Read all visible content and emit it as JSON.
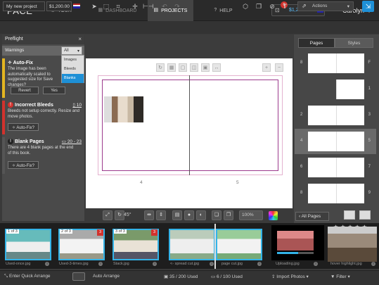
{
  "app": {
    "logo": "PACE"
  },
  "nav": {
    "tour": "TOUR",
    "dashboard": "DASHBOARD",
    "projects": "PROJECTS",
    "help": "HELP"
  },
  "cart": {
    "count": "1",
    "price": "$1,234.56"
  },
  "user": {
    "name": "Carolyn"
  },
  "toolbar": {
    "project_name": "My new project",
    "project_price": "$1,200.00",
    "actions_label": "Actions"
  },
  "preflight": {
    "title": "Preflight",
    "close": "×",
    "filter_label": "Warnings",
    "filter_selected": "All",
    "filter_options": [
      "Images",
      "Bleeds",
      "Blanks"
    ],
    "autofix": {
      "title": "Auto-Fix",
      "body": "The image has been automatically scaled to suggested size for Save changes?",
      "revert": "Revert",
      "yes": "Yes"
    },
    "bleeds": {
      "title": "Incorrect Bleeds",
      "page": "10",
      "body": "Bleeds not setup correctly. Resize and move photos.",
      "autofix": "Auto-Fix?"
    },
    "blank": {
      "title": "Blank Pages",
      "pages": "20 - 23",
      "body": "There are 4 blank pages at the end of this book.",
      "autofix": "Auto-Fix?"
    }
  },
  "canvas": {
    "page_left": "4",
    "page_right": "5",
    "angle": "45°",
    "zoom": "100%"
  },
  "right_panel": {
    "tab_pages": "Pages",
    "tab_styles": "Styles",
    "thumbs": [
      {
        "left": "8",
        "right": "F",
        "single": false
      },
      {
        "left": "",
        "right": "1",
        "single": true
      },
      {
        "left": "2",
        "right": "3",
        "single": false
      },
      {
        "left": "4",
        "right": "5",
        "single": false,
        "selected": true
      },
      {
        "left": "6",
        "right": "7",
        "single": false
      },
      {
        "left": "8",
        "right": "9",
        "single": false
      }
    ],
    "all_pages": "All Pages"
  },
  "filmstrip": [
    {
      "badge": "1 of 3",
      "name": "Used-once.jpg",
      "red": ""
    },
    {
      "badge": "2 of 3",
      "name": "Used-3-times.jpg",
      "red": "3"
    },
    {
      "badge": "3 of 3",
      "name": "Stack.jpg",
      "red": "3"
    },
    {
      "badge": "",
      "name": "<- spread cut.jpg",
      "red": ""
    },
    {
      "badge": "",
      "name": "page cut.jpg",
      "red": ""
    },
    {
      "badge": "",
      "name": "Uploading.jpg",
      "red": ""
    },
    {
      "badge": "",
      "name": "hover highlight.jpg",
      "red": ""
    }
  ],
  "bottom": {
    "quick_arrange": "Enter Quick Arrange",
    "auto_arrange": "Auto Arrange",
    "used_count": "35 / 200 Used",
    "used_count2": "6 / 100 Used",
    "import": "Import Photos",
    "filter": "Filter"
  }
}
